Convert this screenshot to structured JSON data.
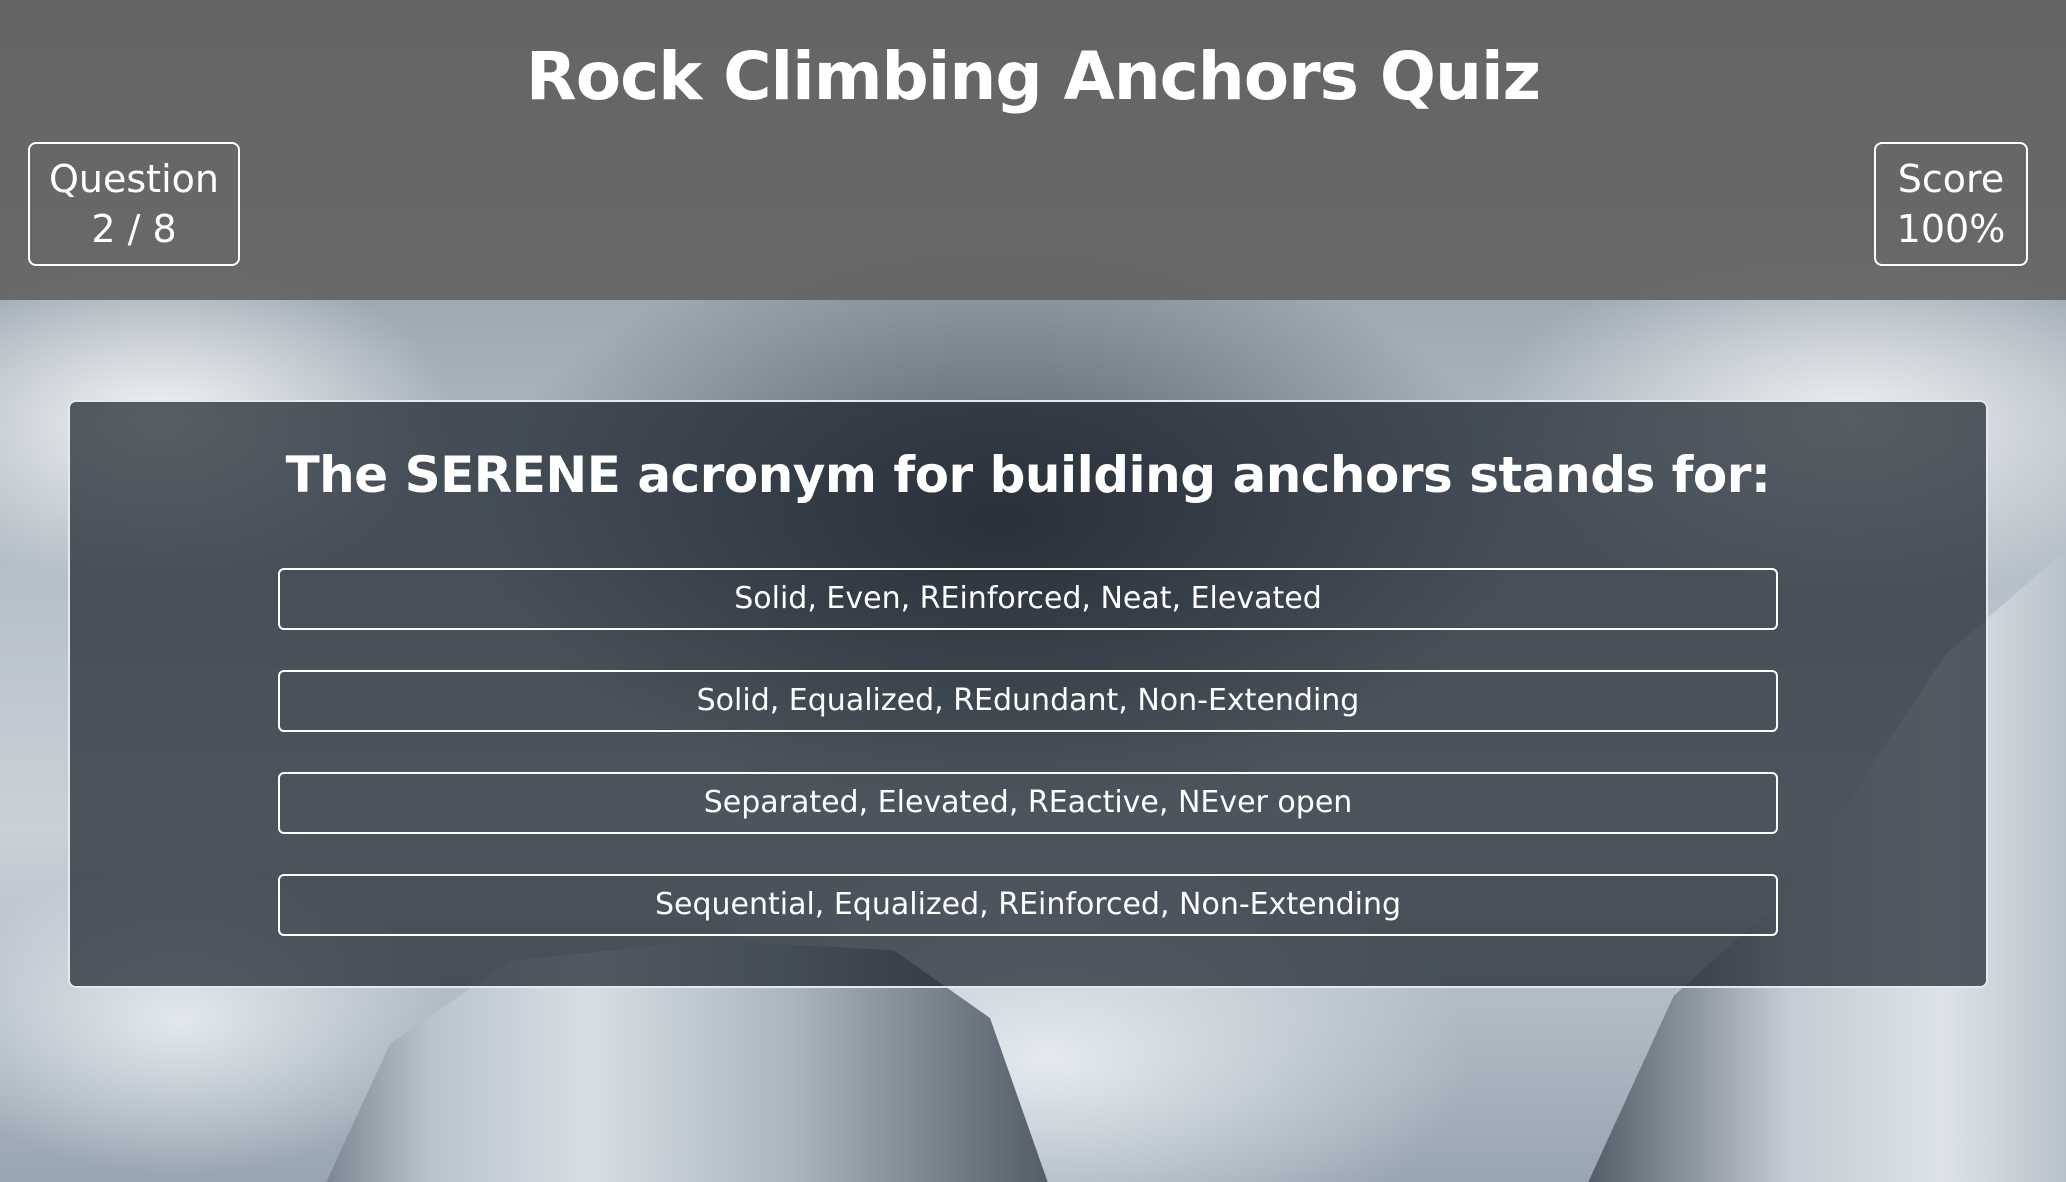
{
  "app": {
    "title": "Rock Climbing Anchors Quiz"
  },
  "hud": {
    "question_label": "Question",
    "question_progress": "2 / 8",
    "score_label": "Score",
    "score_value": "100%"
  },
  "quiz": {
    "question": "The SERENE acronym for building anchors stands for:",
    "answers": [
      "Solid, Even, REinforced, Neat, Elevated",
      "Solid, Equalized, REdundant, Non-Extending",
      "Separated, Elevated, REactive, NEver open",
      "Sequential, Equalized, REinforced, Non-Extending"
    ]
  }
}
